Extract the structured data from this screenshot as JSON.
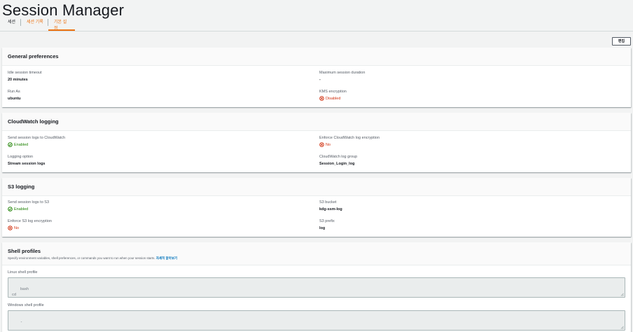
{
  "page": {
    "title": "Session Manager"
  },
  "tabs": [
    {
      "label": "세션",
      "active": false
    },
    {
      "label": "세션 기록",
      "active": false
    },
    {
      "label": "기본 설정",
      "active": true
    }
  ],
  "toolbar": {
    "edit_label": "편집"
  },
  "general": {
    "title": "General preferences",
    "idle_timeout": {
      "label": "Idle session timeout",
      "value": "20 minutes"
    },
    "max_duration": {
      "label": "Maximum session duration",
      "value": "-"
    },
    "run_as": {
      "label": "Run As",
      "value": "ubuntu"
    },
    "kms": {
      "label": "KMS encryption",
      "value": "Disabled",
      "status": "error"
    }
  },
  "cloudwatch": {
    "title": "CloudWatch logging",
    "send": {
      "label": "Send session logs to CloudWatch",
      "value": "Enabled",
      "status": "success"
    },
    "enforce": {
      "label": "Enforce CloudWatch log encryption",
      "value": "No",
      "status": "error"
    },
    "option": {
      "label": "Logging option",
      "value": "Stream session logs"
    },
    "group": {
      "label": "CloudWatch log group",
      "value": "Session_Login_log"
    }
  },
  "s3": {
    "title": "S3 logging",
    "send": {
      "label": "Send session logs to S3",
      "value": "Enabled",
      "status": "success"
    },
    "bucket": {
      "label": "S3 bucket",
      "value": "kdg-ssm-log"
    },
    "enforce": {
      "label": "Enforce S3 log encryption",
      "value": "No",
      "status": "error"
    },
    "prefix": {
      "label": "S3 prefix",
      "value": "log"
    }
  },
  "shell": {
    "title": "Shell profiles",
    "description": "Specify environment variables, shell preferences, or commands you want to run when your session starts.",
    "learn_more": "자세히 알아보기",
    "linux": {
      "label": "Linux shell profile",
      "value": "bash\ncd"
    },
    "windows": {
      "label": "Windows shell profile",
      "value": "-"
    }
  },
  "colors": {
    "accent": "#ec7211",
    "success": "#1d8102",
    "error": "#d13212",
    "link": "#0073bb"
  },
  "icons": {
    "success": "check-circle-icon",
    "error": "x-circle-icon",
    "resize": "resize-grip-icon"
  }
}
